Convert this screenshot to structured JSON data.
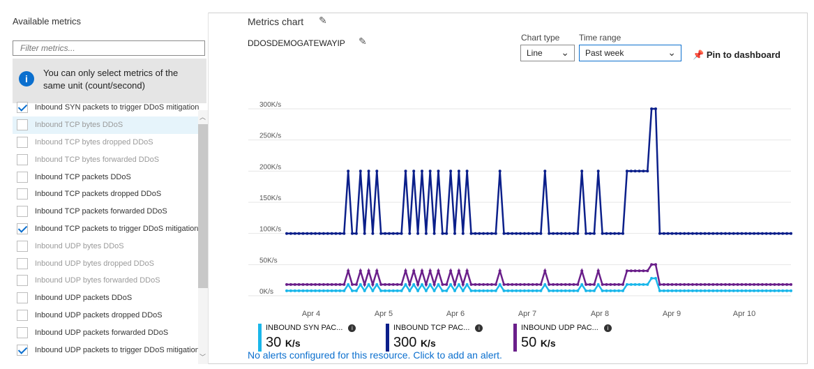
{
  "left": {
    "title": "Available metrics",
    "filter_placeholder": "Filter metrics...",
    "info_text": "You can only select metrics of the same unit (count/second)",
    "items": [
      {
        "label": "Inbound SYN packets to trigger DDoS mitigation",
        "checked": true,
        "dim": false,
        "hover": false
      },
      {
        "label": "Inbound TCP bytes DDoS",
        "checked": false,
        "dim": true,
        "hover": true
      },
      {
        "label": "Inbound TCP bytes dropped DDoS",
        "checked": false,
        "dim": true,
        "hover": false
      },
      {
        "label": "Inbound TCP bytes forwarded DDoS",
        "checked": false,
        "dim": true,
        "hover": false
      },
      {
        "label": "Inbound TCP packets DDoS",
        "checked": false,
        "dim": false,
        "hover": false
      },
      {
        "label": "Inbound TCP packets dropped DDoS",
        "checked": false,
        "dim": false,
        "hover": false
      },
      {
        "label": "Inbound TCP packets forwarded DDoS",
        "checked": false,
        "dim": false,
        "hover": false
      },
      {
        "label": "Inbound TCP packets to trigger DDoS mitigation",
        "checked": true,
        "dim": false,
        "hover": false
      },
      {
        "label": "Inbound UDP bytes DDoS",
        "checked": false,
        "dim": true,
        "hover": false
      },
      {
        "label": "Inbound UDP bytes dropped DDoS",
        "checked": false,
        "dim": true,
        "hover": false
      },
      {
        "label": "Inbound UDP bytes forwarded DDoS",
        "checked": false,
        "dim": true,
        "hover": false
      },
      {
        "label": "Inbound UDP packets DDoS",
        "checked": false,
        "dim": false,
        "hover": false
      },
      {
        "label": "Inbound UDP packets dropped DDoS",
        "checked": false,
        "dim": false,
        "hover": false
      },
      {
        "label": "Inbound UDP packets forwarded DDoS",
        "checked": false,
        "dim": false,
        "hover": false
      },
      {
        "label": "Inbound UDP packets to trigger DDoS mitigation",
        "checked": true,
        "dim": false,
        "hover": false
      }
    ]
  },
  "header": {
    "title": "Metrics chart",
    "resource": "DDOSDEMOGATEWAYIP",
    "chart_type_label": "Chart type",
    "chart_type_value": "Line",
    "time_range_label": "Time range",
    "time_range_value": "Past week",
    "pin_label": "Pin to dashboard"
  },
  "colors": {
    "syn": "#1ab7ea",
    "tcp": "#0b1f8a",
    "udp": "#6a1f8a",
    "accent": "#0b6fce"
  },
  "chart_data": {
    "type": "line",
    "y_ticks": [
      "0K/s",
      "50K/s",
      "100K/s",
      "150K/s",
      "200K/s",
      "250K/s",
      "300K/s"
    ],
    "ylim": [
      0,
      300
    ],
    "x_ticks": [
      "Apr 4",
      "Apr 5",
      "Apr 6",
      "Apr 7",
      "Apr 8",
      "Apr 9",
      "Apr 10"
    ],
    "x": [
      0,
      1,
      2,
      3,
      4,
      5,
      6,
      7,
      8,
      9,
      10,
      11,
      12,
      13,
      14,
      15,
      16,
      17,
      18,
      19,
      20,
      21,
      22,
      23,
      24,
      25,
      26,
      27,
      28,
      29,
      30,
      31,
      32,
      33,
      34,
      35,
      36,
      37,
      38,
      39,
      40,
      41,
      42,
      43,
      44,
      45,
      46,
      47,
      48,
      49,
      50,
      51,
      52,
      53,
      54,
      55,
      56,
      57,
      58,
      59,
      60,
      61,
      62,
      63,
      64,
      65,
      66,
      67,
      68,
      69,
      70,
      71,
      72,
      73,
      74,
      75,
      76,
      77,
      78,
      79,
      80,
      81,
      82,
      83,
      84,
      85,
      86,
      87,
      88,
      89,
      90,
      91,
      92,
      93,
      94,
      95,
      96,
      97,
      98,
      99,
      100,
      101,
      102,
      103,
      104,
      105,
      106,
      107,
      108,
      109,
      110,
      111,
      112,
      113,
      114,
      115,
      116,
      117,
      118,
      119,
      120,
      121,
      122,
      123
    ],
    "series": [
      {
        "name": "INBOUND TCP PAC...",
        "color_key": "tcp",
        "values": [
          100,
          100,
          100,
          100,
          100,
          100,
          100,
          100,
          100,
          100,
          100,
          100,
          100,
          100,
          100,
          200,
          100,
          100,
          200,
          100,
          200,
          100,
          200,
          100,
          100,
          100,
          100,
          100,
          100,
          200,
          100,
          200,
          100,
          200,
          100,
          200,
          100,
          200,
          100,
          100,
          200,
          100,
          200,
          100,
          200,
          100,
          100,
          100,
          100,
          100,
          100,
          100,
          200,
          100,
          100,
          100,
          100,
          100,
          100,
          100,
          100,
          100,
          100,
          200,
          100,
          100,
          100,
          100,
          100,
          100,
          100,
          100,
          200,
          100,
          100,
          100,
          200,
          100,
          100,
          100,
          100,
          100,
          100,
          200,
          200,
          200,
          200,
          200,
          200,
          300,
          300,
          100,
          100,
          100,
          100,
          100,
          100,
          100,
          100,
          100,
          100,
          100,
          100,
          100,
          100,
          100,
          100,
          100,
          100,
          100,
          100,
          100,
          100,
          100,
          100,
          100,
          100,
          100,
          100,
          100,
          100,
          100,
          100,
          100
        ]
      },
      {
        "name": "INBOUND UDP PAC...",
        "color_key": "udp",
        "values": [
          18,
          18,
          18,
          18,
          18,
          18,
          18,
          18,
          18,
          18,
          18,
          18,
          18,
          18,
          18,
          40,
          18,
          18,
          40,
          18,
          40,
          18,
          40,
          18,
          18,
          18,
          18,
          18,
          18,
          40,
          18,
          40,
          18,
          40,
          18,
          40,
          18,
          40,
          18,
          18,
          40,
          18,
          40,
          18,
          40,
          18,
          18,
          18,
          18,
          18,
          18,
          18,
          40,
          18,
          18,
          18,
          18,
          18,
          18,
          18,
          18,
          18,
          18,
          40,
          18,
          18,
          18,
          18,
          18,
          18,
          18,
          18,
          40,
          18,
          18,
          18,
          40,
          18,
          18,
          18,
          18,
          18,
          18,
          40,
          40,
          40,
          40,
          40,
          40,
          50,
          50,
          18,
          18,
          18,
          18,
          18,
          18,
          18,
          18,
          18,
          18,
          18,
          18,
          18,
          18,
          18,
          18,
          18,
          18,
          18,
          18,
          18,
          18,
          18,
          18,
          18,
          18,
          18,
          18,
          18,
          18,
          18,
          18,
          18
        ]
      },
      {
        "name": "INBOUND SYN PAC...",
        "color_key": "syn",
        "values": [
          8,
          8,
          8,
          8,
          8,
          8,
          8,
          8,
          8,
          8,
          8,
          8,
          8,
          8,
          8,
          18,
          8,
          8,
          18,
          8,
          18,
          8,
          18,
          8,
          8,
          8,
          8,
          8,
          8,
          18,
          8,
          18,
          8,
          18,
          8,
          18,
          8,
          18,
          8,
          8,
          18,
          8,
          18,
          8,
          18,
          8,
          8,
          8,
          8,
          8,
          8,
          8,
          18,
          8,
          8,
          8,
          8,
          8,
          8,
          8,
          8,
          8,
          8,
          18,
          8,
          8,
          8,
          8,
          8,
          8,
          8,
          8,
          18,
          8,
          8,
          8,
          18,
          8,
          8,
          8,
          8,
          8,
          8,
          18,
          18,
          18,
          18,
          18,
          18,
          28,
          28,
          8,
          8,
          8,
          8,
          8,
          8,
          8,
          8,
          8,
          8,
          8,
          8,
          8,
          8,
          8,
          8,
          8,
          8,
          8,
          8,
          8,
          8,
          8,
          8,
          8,
          8,
          8,
          8,
          8,
          8,
          8,
          8,
          8
        ]
      }
    ],
    "grid": true
  },
  "legend": [
    {
      "name": "INBOUND SYN PAC...",
      "value": "30",
      "unit": "K/s",
      "color_key": "syn"
    },
    {
      "name": "INBOUND TCP PAC...",
      "value": "300",
      "unit": "K/s",
      "color_key": "tcp"
    },
    {
      "name": "INBOUND UDP PAC...",
      "value": "50",
      "unit": "K/s",
      "color_key": "udp"
    }
  ],
  "alert_text": "No alerts configured for this resource. Click to add an alert."
}
